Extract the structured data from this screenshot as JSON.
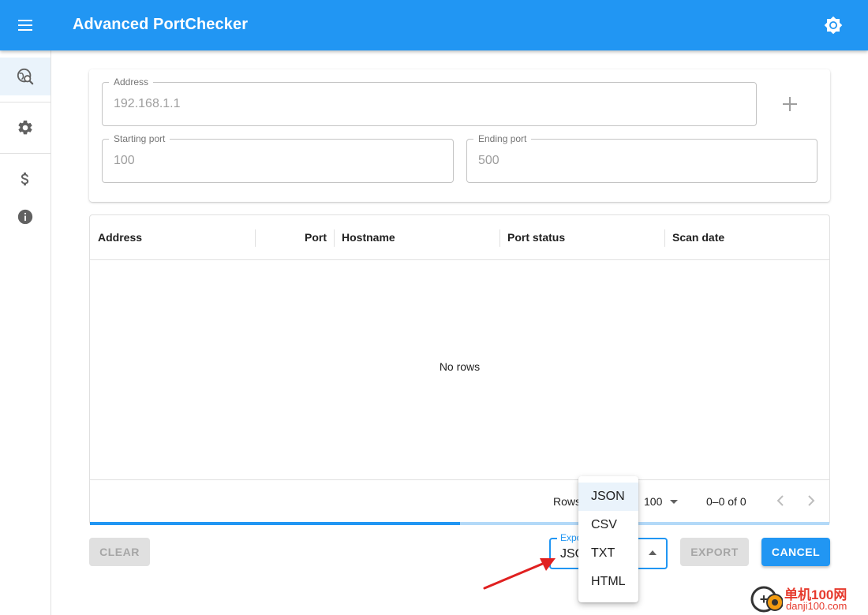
{
  "app": {
    "title": "Advanced PortChecker"
  },
  "rail": {
    "items": [
      {
        "name": "scan",
        "icon": "globe-search-icon"
      },
      {
        "name": "settings",
        "icon": "gear-icon"
      },
      {
        "name": "donate",
        "icon": "dollar-icon"
      },
      {
        "name": "about",
        "icon": "info-icon"
      }
    ]
  },
  "form": {
    "address": {
      "label": "Address",
      "value": "192.168.1.1"
    },
    "starting_port": {
      "label": "Starting port",
      "value": "100"
    },
    "ending_port": {
      "label": "Ending port",
      "value": "500"
    }
  },
  "grid": {
    "columns": [
      "Address",
      "Port",
      "Hostname",
      "Port status",
      "Scan date"
    ],
    "empty_text": "No rows",
    "footer": {
      "rows_label": "Rows",
      "page_size": "100",
      "range": "0–0 of 0"
    },
    "progress_fraction": 0.5
  },
  "actions": {
    "clear_label": "CLEAR",
    "export_select": {
      "label": "Expo",
      "value": "JSO"
    },
    "export_label": "EXPORT",
    "cancel_label": "CANCEL"
  },
  "export_menu": {
    "options": [
      "JSON",
      "CSV",
      "TXT",
      "HTML"
    ],
    "selected": "JSON"
  },
  "watermark": {
    "cn": "单机100网",
    "en": "danji100.com"
  },
  "colors": {
    "primary": "#2196f3",
    "annotation": "#e02020",
    "watermark": "#e63b2e"
  }
}
